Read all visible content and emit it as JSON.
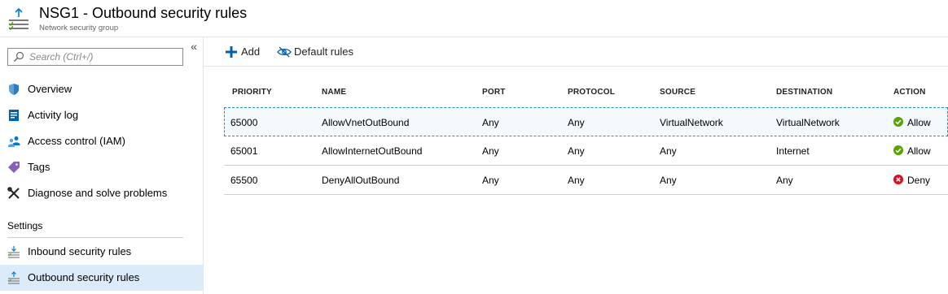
{
  "header": {
    "title": "NSG1 - Outbound security rules",
    "subtitle": "Network security group",
    "icon": "outbound-rules-icon"
  },
  "sidebar": {
    "search_placeholder": "Search (Ctrl+/)",
    "collapse_glyph": "«",
    "items": [
      {
        "label": "Overview",
        "icon": "shield-icon"
      },
      {
        "label": "Activity log",
        "icon": "activity-log-icon"
      },
      {
        "label": "Access control (IAM)",
        "icon": "people-icon"
      },
      {
        "label": "Tags",
        "icon": "tag-icon"
      },
      {
        "label": "Diagnose and solve problems",
        "icon": "wrench-icon"
      }
    ],
    "section_label": "Settings",
    "settings_items": [
      {
        "label": "Inbound security rules",
        "icon": "inbound-rules-icon"
      },
      {
        "label": "Outbound security rules",
        "icon": "outbound-rules-icon",
        "active": true
      }
    ]
  },
  "toolbar": {
    "add_label": "Add",
    "default_rules_label": "Default rules"
  },
  "table": {
    "columns": [
      "PRIORITY",
      "NAME",
      "PORT",
      "PROTOCOL",
      "SOURCE",
      "DESTINATION",
      "ACTION"
    ],
    "rows": [
      {
        "priority": "65000",
        "name": "AllowVnetOutBound",
        "port": "Any",
        "protocol": "Any",
        "source": "VirtualNetwork",
        "destination": "VirtualNetwork",
        "action": "Allow",
        "action_type": "allow",
        "selected": true
      },
      {
        "priority": "65001",
        "name": "AllowInternetOutBound",
        "port": "Any",
        "protocol": "Any",
        "source": "Any",
        "destination": "Internet",
        "action": "Allow",
        "action_type": "allow"
      },
      {
        "priority": "65500",
        "name": "DenyAllOutBound",
        "port": "Any",
        "protocol": "Any",
        "source": "Any",
        "destination": "Any",
        "action": "Deny",
        "action_type": "deny"
      }
    ]
  },
  "colors": {
    "accent": "#0078d4",
    "allow": "#57a300",
    "deny": "#e00b1c",
    "active_nav_bg": "#dcebfa"
  }
}
